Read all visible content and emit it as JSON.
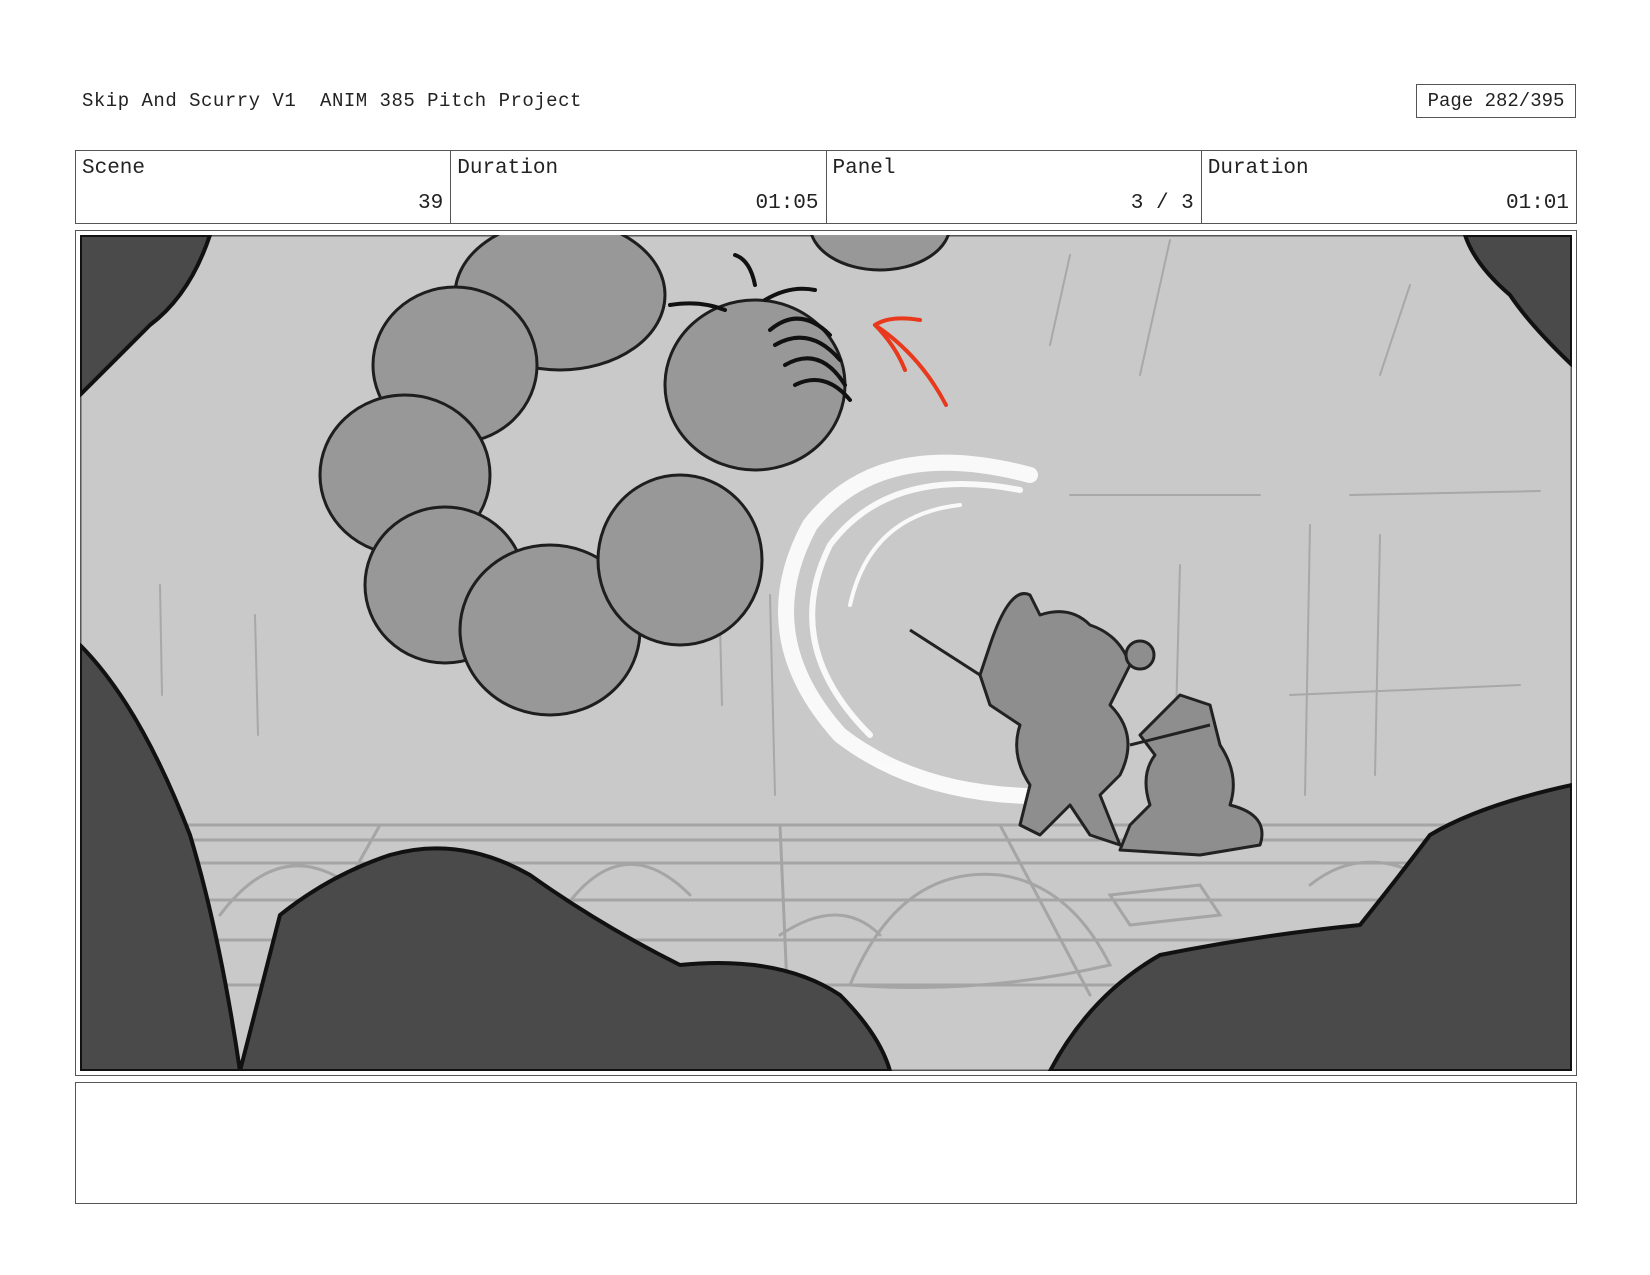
{
  "header": {
    "title": "Skip And Scurry V1  ANIM 385 Pitch Project",
    "page": "Page 282/395"
  },
  "info": {
    "scene_label": "Scene",
    "scene_value": "39",
    "duration_label": "Duration",
    "duration_value": "01:05",
    "panel_label": "Panel",
    "panel_value": "3 / 3",
    "panel_duration_label": "Duration",
    "panel_duration_value": "01:01"
  },
  "notes": {
    "text": ""
  },
  "colors": {
    "background": "#c9c9c9",
    "rocks": "#4a4a4a",
    "smoke": "#989898",
    "accent_arrow": "#e8391d",
    "magic_trail": "#ffffff"
  }
}
